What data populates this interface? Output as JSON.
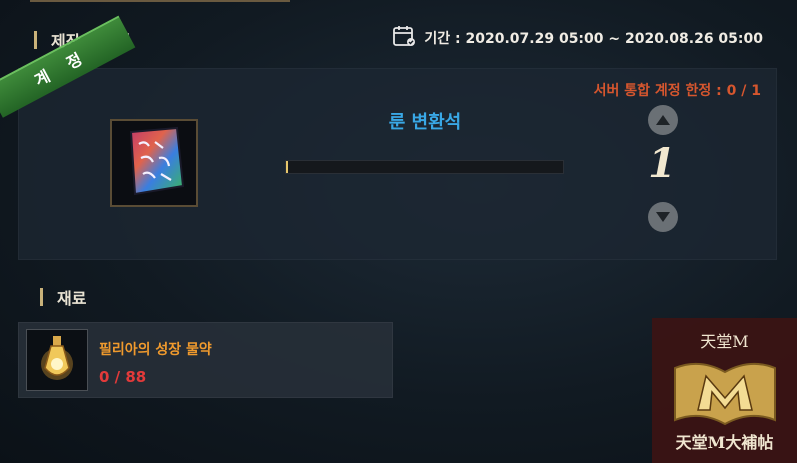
{
  "header": {
    "title": "제작 아이템",
    "period_label": "기간 : 2020.07.29 05:00 ~ 2020.08.26 05:00",
    "calendar_icon": "calendar-icon"
  },
  "craft": {
    "badge": "계 정",
    "limit": "서버 통합 계정 한정 : 0 / 1",
    "item_name": "룬 변환석",
    "item_icon": "rune-stone-icon",
    "progress": 0,
    "quantity": "1",
    "colors": {
      "limit": "#d6562e",
      "item_name": "#39a8e6",
      "badge": "#2f7a32"
    }
  },
  "materials": {
    "title": "재료",
    "items": [
      {
        "name": "필리아의 성장 물약",
        "count": "0 / 88",
        "icon": "potion-bottle-icon"
      }
    ],
    "colors": {
      "name": "#f09a2d",
      "count": "#e33a3a"
    }
  },
  "watermark": {
    "top": "天堂M",
    "bottom": "天堂M大補帖"
  }
}
